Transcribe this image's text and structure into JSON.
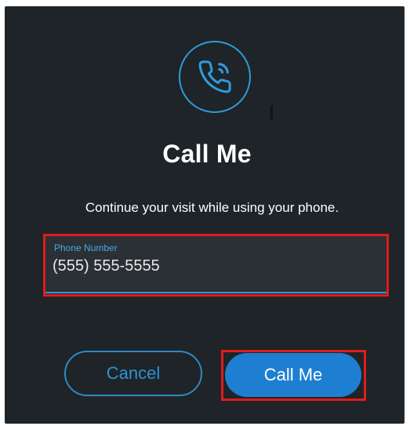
{
  "dialog": {
    "icon": "phone-icon",
    "title": "Call Me",
    "subtitle": "Continue your visit while using your phone.",
    "phone_field": {
      "label": "Phone Number",
      "value": "(555) 555-5555"
    },
    "cancel_label": "Cancel",
    "call_label": "Call Me"
  },
  "colors": {
    "background": "#1f2428",
    "accent": "#2d9cdb",
    "primary_button": "#1e7fd2",
    "highlight": "#e21b1b"
  }
}
